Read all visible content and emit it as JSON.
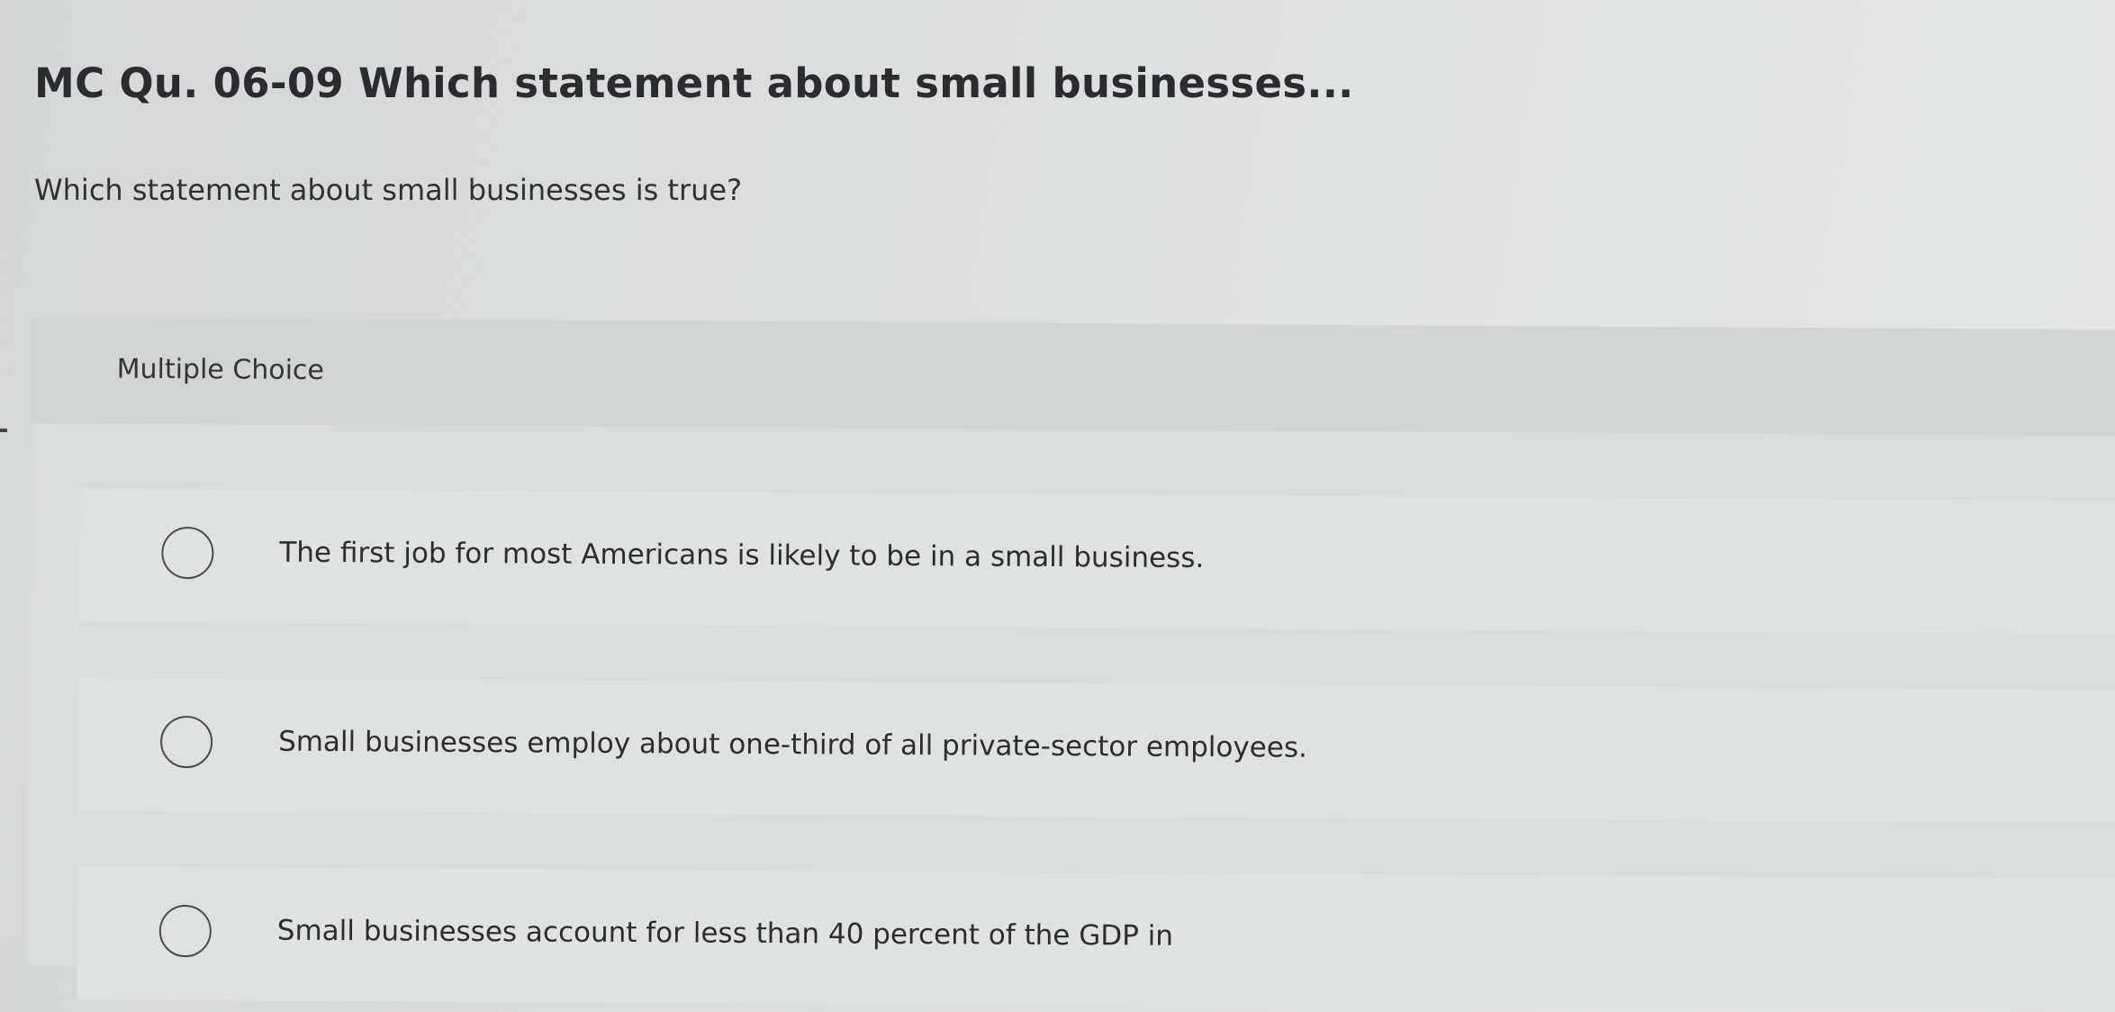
{
  "question": {
    "title": "MC Qu. 06-09 Which statement about small businesses...",
    "prompt": "Which statement about small businesses is true?"
  },
  "multiple_choice": {
    "header": "Multiple Choice",
    "options": [
      {
        "label": "The first job for most Americans is likely to be in a small business.",
        "selected": false
      },
      {
        "label": "Small businesses employ about one-third of all private-sector employees.",
        "selected": false
      },
      {
        "label": "Small businesses account for less than 40 percent of the GDP in",
        "selected": false
      }
    ]
  }
}
